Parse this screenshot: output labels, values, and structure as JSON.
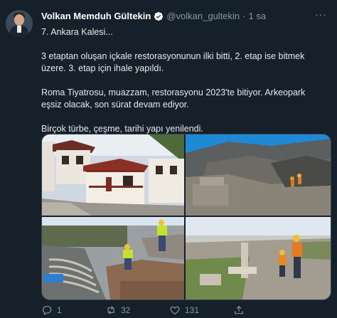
{
  "tweet": {
    "author_name": "Volkan Memduh Gültekin",
    "handle": "@volkan_gultekin",
    "time": "1 sa",
    "paragraphs": [
      "7. Ankara Kalesi...",
      "3 etaptan oluşan içkale restorasyonunun ilki bitti, 2. etap ise bitmek üzere. 3. etap için ihale yapıldı.",
      "Roma Tiyatrosu, muazzam, restorasyonu 2023'te bitiyor. Arkeopark eşsiz olacak, son sürat devam ediyor.",
      "Birçok türbe, çeşme, tarihi yapı yenilendi."
    ],
    "replies": "1",
    "retweets": "32",
    "likes": "131"
  },
  "icons": {
    "verified": "verified-badge-icon",
    "more": "more-options-icon",
    "reply": "reply-icon",
    "retweet": "retweet-icon",
    "like": "heart-icon",
    "share": "share-icon"
  },
  "colors": {
    "background": "#15202b",
    "muted": "#8899a6",
    "verified": "#1d9bf0",
    "border": "#38444d"
  }
}
